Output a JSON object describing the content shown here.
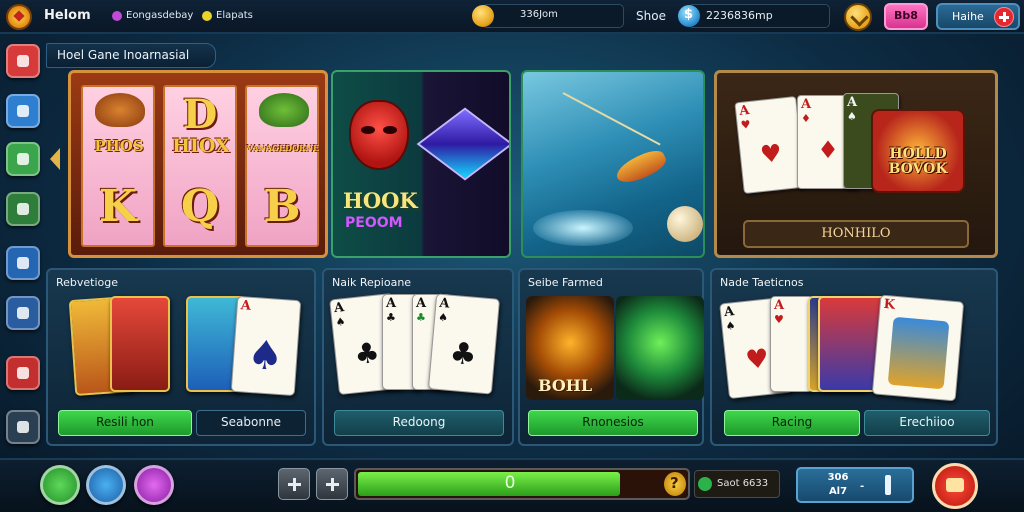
{
  "topbar": {
    "app_title": "Helom",
    "nav_items": [
      "Eongasdebay",
      "Elapats"
    ],
    "coins_value": "336Jom",
    "shop_label": "Shoe",
    "gems_value": "2236836mp",
    "pink_button_label": "Bb8",
    "help_label": "Haihe"
  },
  "sidebar": {
    "items": [
      {
        "icon": "star-icon",
        "color": "#d63a3a"
      },
      {
        "icon": "bird-icon",
        "color": "#2f7fd1"
      },
      {
        "icon": "leaf-icon",
        "color": "#3aa54a"
      },
      {
        "icon": "scroll-icon",
        "color": "#2e7d3a"
      },
      {
        "icon": "chart-icon",
        "color": "#2566b3"
      },
      {
        "icon": "book-icon",
        "color": "#2a5da0"
      },
      {
        "icon": "fire-icon",
        "color": "#c32e2e"
      },
      {
        "icon": "back-arrow-icon",
        "color": "#2b3f52"
      }
    ]
  },
  "section": {
    "title": "Hoel Gane Inoarnasial"
  },
  "featured": {
    "slot": {
      "words": [
        "PHOS",
        "HIOX",
        "VANAGEDORNE"
      ],
      "letters_top": [
        "",
        "D",
        ""
      ],
      "letters_bottom": [
        "K",
        "Q",
        "B"
      ]
    },
    "hook": {
      "title": "HOOK",
      "subtitle": "PEOOM"
    },
    "cards": {
      "emblem": "HOLLD\nBOVOK",
      "label": "HONHILO"
    }
  },
  "panels": [
    {
      "title": "Rebvetioge",
      "buttons": [
        "Resili hon",
        "Seabonne"
      ]
    },
    {
      "title": "Naik Repioane",
      "buttons": [
        "Redoong"
      ]
    },
    {
      "title": "Seibe Farmed",
      "orb_word": "BOHL",
      "buttons": [
        "Rnonesios"
      ]
    },
    {
      "title": "Nade Taeticnos",
      "buttons": [
        "Racing",
        "Erechiioo"
      ]
    }
  ],
  "bottombar": {
    "progress_value": "0",
    "progress_fraction": 0.8,
    "score_text": "Saot 6633",
    "stats_line1": "306",
    "stats_line2": "Al7",
    "stats_sep": "-",
    "round_buttons": [
      {
        "icon": "star-icon",
        "color": "#3aa54a"
      },
      {
        "icon": "shield-icon",
        "color": "#1d7fc4"
      },
      {
        "icon": "refresh-icon",
        "color": "#c23bd1"
      }
    ]
  }
}
